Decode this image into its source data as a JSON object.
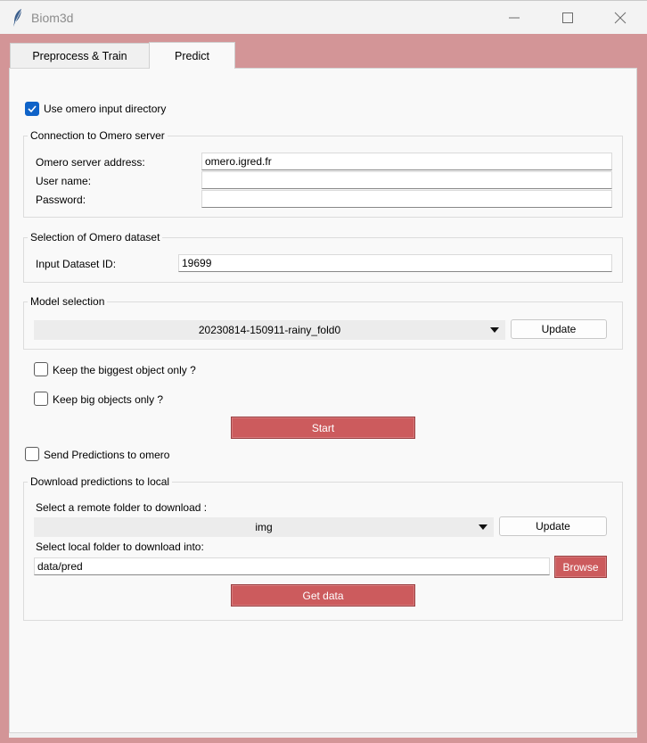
{
  "window": {
    "title": "Biom3d"
  },
  "tabs": [
    {
      "label": "Preprocess & Train"
    },
    {
      "label": "Predict"
    }
  ],
  "omero_toggle": {
    "label": "Use omero input directory",
    "checked": true
  },
  "connection": {
    "title": "Connection to Omero server",
    "server_label": "Omero server address:",
    "server_value": "omero.igred.fr",
    "user_label": "User name:",
    "user_value": "",
    "password_label": "Password:",
    "password_value": ""
  },
  "dataset": {
    "title": "Selection of Omero dataset",
    "id_label": "Input Dataset ID:",
    "id_value": "19699"
  },
  "model": {
    "title": "Model selection",
    "selected": "20230814-150911-rainy_fold0",
    "update_label": "Update"
  },
  "options": {
    "biggest_label": "Keep the biggest object only ?",
    "big_label": "Keep big objects only ?"
  },
  "start_label": "Start",
  "send_predictions": {
    "label": "Send Predictions to omero"
  },
  "download": {
    "title": "Download predictions to local",
    "remote_label": "Select a remote folder to download :",
    "remote_selected": "img",
    "update_label": "Update",
    "local_label": "Select local folder to download into:",
    "local_value": "data/pred",
    "browse_label": "Browse",
    "get_label": "Get data"
  },
  "colors": {
    "accent": "#cc5b5d",
    "check": "#0f63c8",
    "background": "#d39597"
  }
}
